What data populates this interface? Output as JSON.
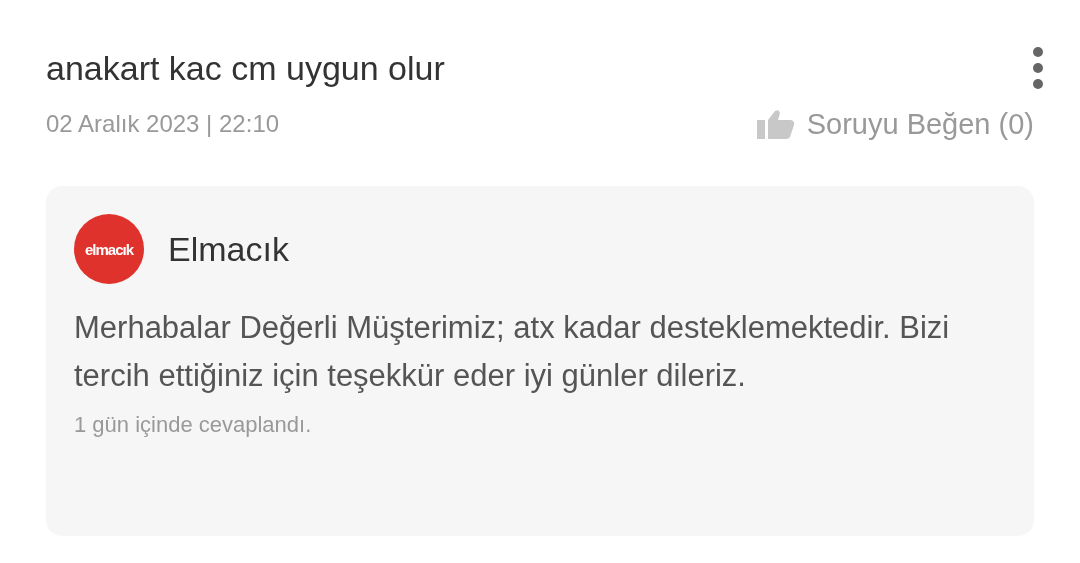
{
  "question": {
    "title": "anakart kac cm uygun olur",
    "date": "02 Aralık 2023 | 22:10",
    "like_label": "Soruyu Beğen (0)"
  },
  "answer": {
    "logo_text": "elmacık",
    "seller": "Elmacık",
    "text": "Merhabalar Değerli Müşterimiz; atx kadar desteklemektedir. Bizi tercih ettiğiniz için teşekkür eder iyi günler dileriz.",
    "answered_in": "1 gün içinde cevaplandı."
  }
}
